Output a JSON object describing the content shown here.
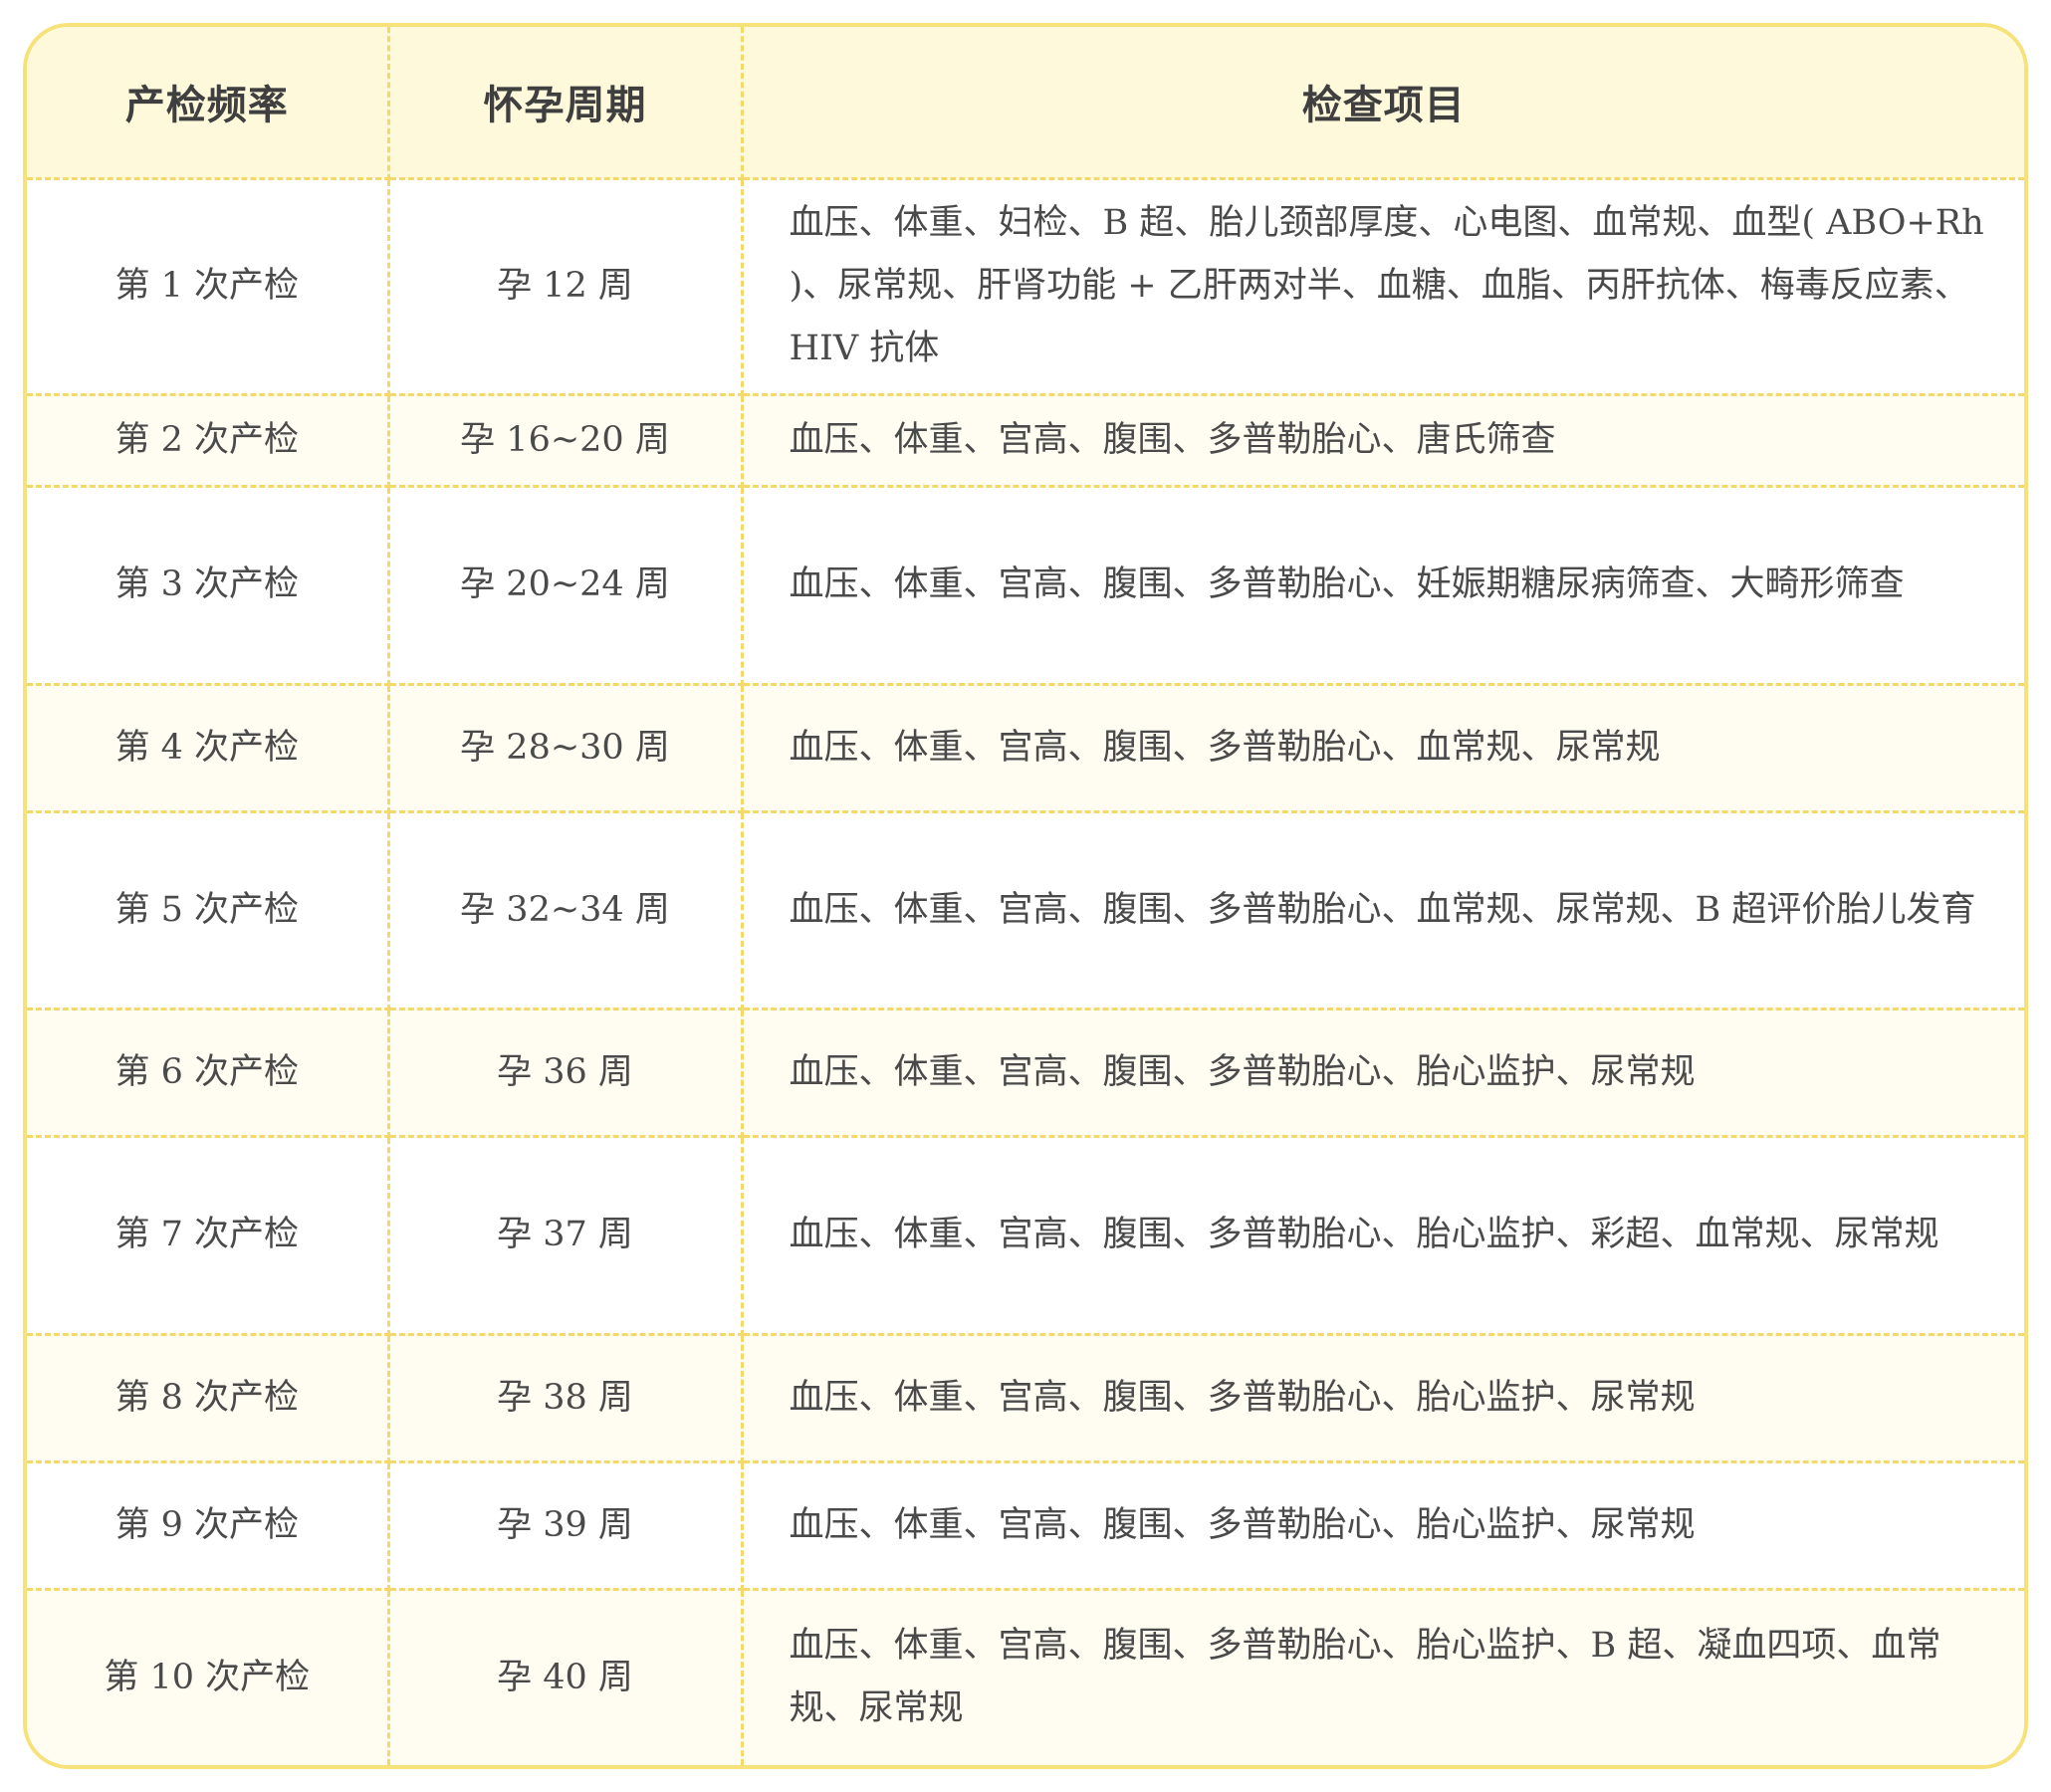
{
  "colors": {
    "border": "#f7e27a",
    "header_bg": "#fff9dc",
    "stripe_bg": "#fffdf1",
    "text": "#4a4a4a"
  },
  "table": {
    "headers": [
      "产检频率",
      "怀孕周期",
      "检查项目"
    ],
    "rows": [
      {
        "frequency": "第 1 次产检",
        "period": "孕 12 周",
        "items": "血压、体重、妇检、B 超、胎儿颈部厚度、心电图、血常规、血型( ABO+Rh )、尿常规、肝肾功能 + 乙肝两对半、血糖、血脂、丙肝抗体、梅毒反应素、HIV 抗体"
      },
      {
        "frequency": "第 2 次产检",
        "period": "孕 16~20 周",
        "items": "血压、体重、宫高、腹围、多普勒胎心、唐氏筛查"
      },
      {
        "frequency": "第 3 次产检",
        "period": "孕 20~24 周",
        "items": "血压、体重、宫高、腹围、多普勒胎心、妊娠期糖尿病筛查、大畸形筛查"
      },
      {
        "frequency": "第 4 次产检",
        "period": "孕 28~30 周",
        "items": "血压、体重、宫高、腹围、多普勒胎心、血常规、尿常规"
      },
      {
        "frequency": "第 5 次产检",
        "period": "孕 32~34 周",
        "items": "血压、体重、宫高、腹围、多普勒胎心、血常规、尿常规、B 超评价胎儿发育"
      },
      {
        "frequency": "第 6 次产检",
        "period": "孕 36 周",
        "items": "血压、体重、宫高、腹围、多普勒胎心、胎心监护、尿常规"
      },
      {
        "frequency": "第 7 次产检",
        "period": "孕 37 周",
        "items": "血压、体重、宫高、腹围、多普勒胎心、胎心监护、彩超、血常规、尿常规"
      },
      {
        "frequency": "第 8 次产检",
        "period": "孕 38 周",
        "items": "血压、体重、宫高、腹围、多普勒胎心、胎心监护、尿常规"
      },
      {
        "frequency": "第 9 次产检",
        "period": "孕 39 周",
        "items": "血压、体重、宫高、腹围、多普勒胎心、胎心监护、尿常规"
      },
      {
        "frequency": "第 10 次产检",
        "period": "孕 40 周",
        "items": "血压、体重、宫高、腹围、多普勒胎心、胎心监护、B 超、凝血四项、血常规、尿常规"
      }
    ]
  }
}
